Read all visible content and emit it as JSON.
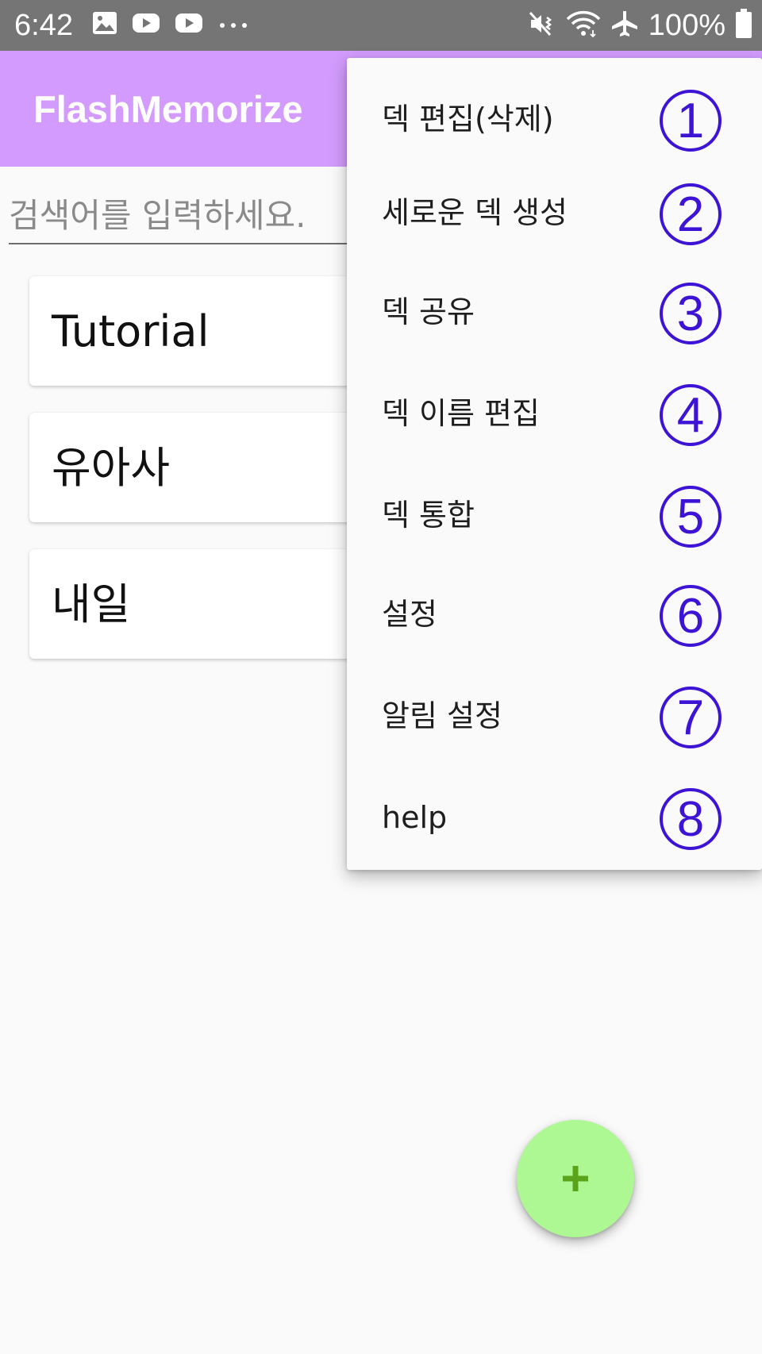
{
  "status_bar": {
    "time": "6:42",
    "battery": "100%",
    "icons": [
      "gallery-icon",
      "youtube-icon",
      "youtube-icon",
      "more-icon",
      "mute-vibrate-icon",
      "wifi-icon",
      "airplane-mode-icon",
      "battery-icon"
    ]
  },
  "app_bar": {
    "title": "FlashMemorize",
    "color": "#d29bfd"
  },
  "search": {
    "placeholder": "검색어를 입력하세요."
  },
  "decks": [
    {
      "name": "Tutorial"
    },
    {
      "name": "유아사"
    },
    {
      "name": "내일"
    }
  ],
  "menu": {
    "items": [
      {
        "label": "덱 편집(삭제)",
        "badge": "1"
      },
      {
        "label": "세로운 덱 생성",
        "badge": "2"
      },
      {
        "label": "덱 공유",
        "badge": "3"
      },
      {
        "label": "덱 이름 편집",
        "badge": "4"
      },
      {
        "label": "덱 통합",
        "badge": "5"
      },
      {
        "label": "설정",
        "badge": "6"
      },
      {
        "label": "알림 설정",
        "badge": "7"
      },
      {
        "label": "help",
        "badge": "8"
      }
    ],
    "badge_color": "#3d14d6"
  },
  "fab": {
    "icon": "plus-icon",
    "color": "#adf892",
    "icon_color": "#5aa31b"
  }
}
